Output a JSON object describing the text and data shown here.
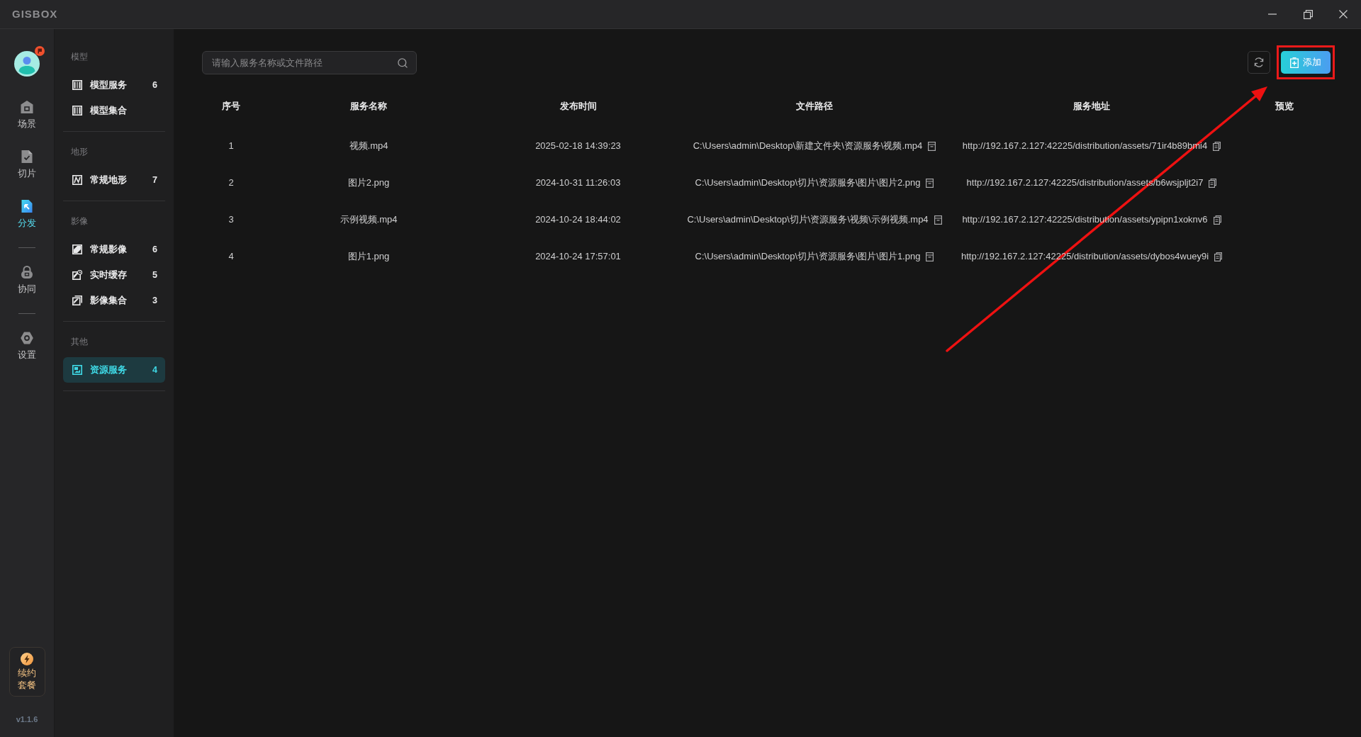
{
  "window": {
    "logo": "GISBOX"
  },
  "nav_rail": {
    "groups": [
      [
        {
          "label": "场景",
          "selected": false
        },
        {
          "label": "切片",
          "selected": false
        },
        {
          "label": "分发",
          "selected": true
        }
      ],
      [
        {
          "label": "协同",
          "selected": false
        }
      ],
      [
        {
          "label": "设置",
          "selected": false
        }
      ]
    ],
    "renew_button": "续约套餐",
    "version": "v1.1.6"
  },
  "sidebar": {
    "sections": [
      {
        "title": "模型",
        "items": [
          {
            "label": "模型服务",
            "count": "6",
            "selected": false
          },
          {
            "label": "模型集合",
            "selected": false
          }
        ]
      },
      {
        "title": "地形",
        "items": [
          {
            "label": "常规地形",
            "count": "7",
            "selected": false
          }
        ]
      },
      {
        "title": "影像",
        "items": [
          {
            "label": "常规影像",
            "count": "6",
            "selected": false
          },
          {
            "label": "实时缓存",
            "count": "5",
            "selected": false
          },
          {
            "label": "影像集合",
            "count": "3",
            "selected": false
          }
        ]
      },
      {
        "title": "其他",
        "items": [
          {
            "label": "资源服务",
            "count": "4",
            "selected": true
          }
        ]
      }
    ]
  },
  "search": {
    "placeholder": "请输入服务名称或文件路径"
  },
  "toolbar": {
    "add_button": "添加"
  },
  "table": {
    "columns": [
      "序号",
      "服务名称",
      "发布时间",
      "文件路径",
      "服务地址",
      "预览"
    ],
    "rows": [
      {
        "index": "1",
        "name": "视频.mp4",
        "published": "2025-02-18 14:39:23",
        "file_path": "C:\\Users\\admin\\Desktop\\新建文件夹\\资源服务\\视频.mp4",
        "service_url": "http://192.167.2.127:42225/distribution/assets/71ir4b89bmi4"
      },
      {
        "index": "2",
        "name": "图片2.png",
        "published": "2024-10-31 11:26:03",
        "file_path": "C:\\Users\\admin\\Desktop\\切片\\资源服务\\图片\\图片2.png",
        "service_url": "http://192.167.2.127:42225/distribution/assets/b6wsjpljt2i7"
      },
      {
        "index": "3",
        "name": "示例视频.mp4",
        "published": "2024-10-24 18:44:02",
        "file_path": "C:\\Users\\admin\\Desktop\\切片\\资源服务\\视频\\示例视频.mp4",
        "service_url": "http://192.167.2.127:42225/distribution/assets/ypipn1xoknv6"
      },
      {
        "index": "4",
        "name": "图片1.png",
        "published": "2024-10-24 17:57:01",
        "file_path": "C:\\Users\\admin\\Desktop\\切片\\资源服务\\图片\\图片1.png",
        "service_url": "http://192.167.2.127:42225/distribution/assets/dybos4wuey9i"
      }
    ]
  },
  "annotations": {
    "highlight_frame": true,
    "arrow": true
  }
}
